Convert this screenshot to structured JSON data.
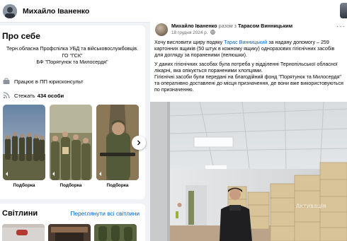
{
  "header": {
    "profile_name": "Михайло Іваненко"
  },
  "about": {
    "title": "Про себе",
    "bio_lines": [
      "Терн.обласна Профспілка УБД та військовослужбовців.",
      "ГО \"ГСК\"",
      "БФ \"Порятунок та Милосердя\""
    ],
    "work": "Працює в ПП юрисконсульт",
    "followers_prefix": "Стежать",
    "followers_count": "434 особи",
    "stories": [
      {
        "label": "Подборка"
      },
      {
        "label": "Подборка"
      },
      {
        "label": "Подборка"
      }
    ]
  },
  "highlights": {
    "title": "Світлини",
    "see_all": "Переглянути всі світлини"
  },
  "post": {
    "author": "Михайло Іваненко",
    "with_text": "разом з",
    "tagged": "Тарасом Винницьким",
    "date": "18 грудня 2024 р.",
    "p1_before": "Хочу висловити щиру подяку",
    "p1_link": "Тарас Винницький",
    "p1_after": "за надану допомогу – 259",
    "p1_line2": "картонних ящиків (50 штук в кожному ящику) одноразових гігієнічних засобів",
    "p1_line3": "для догляду за пораненими (пелюшки).",
    "p2_line1": "У даних гігієнічних засобах була потреба у відділенні Тернопільської обласної",
    "p2_line2": "лікарні, яка опікується пораненими хлопцями.",
    "p2_line3": "Гігієнічні засоби були передані на благодійний фонд \"Порятунок та Милосердя\"",
    "p2_line4": "та оперативно доставлені до місця призначення, де вони вже використовуються",
    "p2_line5": "по призначенню."
  },
  "colors": {
    "link": "#0064d1",
    "background": "#f0f2f5",
    "card": "#ffffff",
    "muted": "#65676b"
  }
}
